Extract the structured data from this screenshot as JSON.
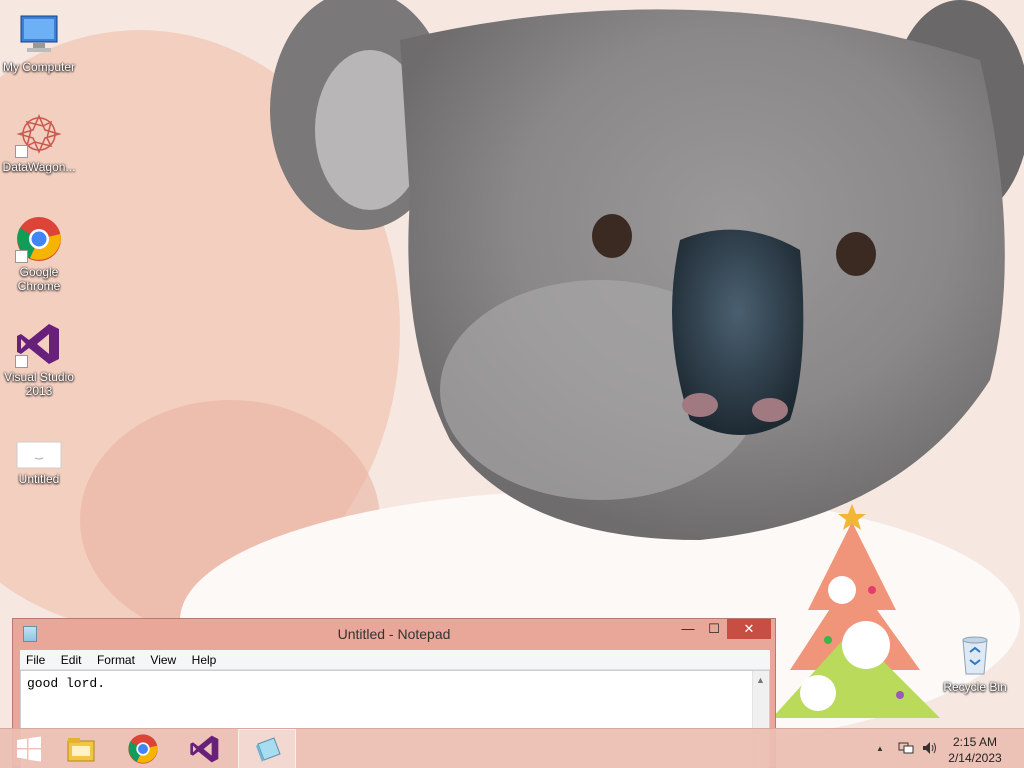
{
  "desktop": {
    "icons": [
      {
        "label": "My Computer",
        "icon": "computer-icon"
      },
      {
        "label": "DataWagon...",
        "icon": "datawagon-icon"
      },
      {
        "label": "Google Chrome",
        "icon": "chrome-icon"
      },
      {
        "label": "Visual Studio 2013",
        "icon": "visual-studio-icon"
      },
      {
        "label": "Untitled",
        "icon": "document-icon"
      },
      {
        "label": "Recycle Bin",
        "icon": "recycle-bin-icon"
      }
    ]
  },
  "notepad": {
    "title": "Untitled - Notepad",
    "menu": [
      "File",
      "Edit",
      "Format",
      "View",
      "Help"
    ],
    "content": "good lord.",
    "controls": {
      "minimize": "—",
      "maximize": "☐",
      "close": "✕"
    }
  },
  "taskbar": {
    "items": [
      "windows-start-icon",
      "file-explorer-icon",
      "chrome-icon",
      "visual-studio-icon",
      "notepad-icon"
    ],
    "active": "notepad-icon",
    "tray": {
      "up_arrow": "▲",
      "volume": "🔈"
    },
    "clock": {
      "time": "2:15 AM",
      "date": "2/14/2023"
    }
  },
  "colors": {
    "taskbar": "#ecbeb2",
    "notepad_frame": "#e9a79a",
    "close_button": "#c74e42"
  }
}
